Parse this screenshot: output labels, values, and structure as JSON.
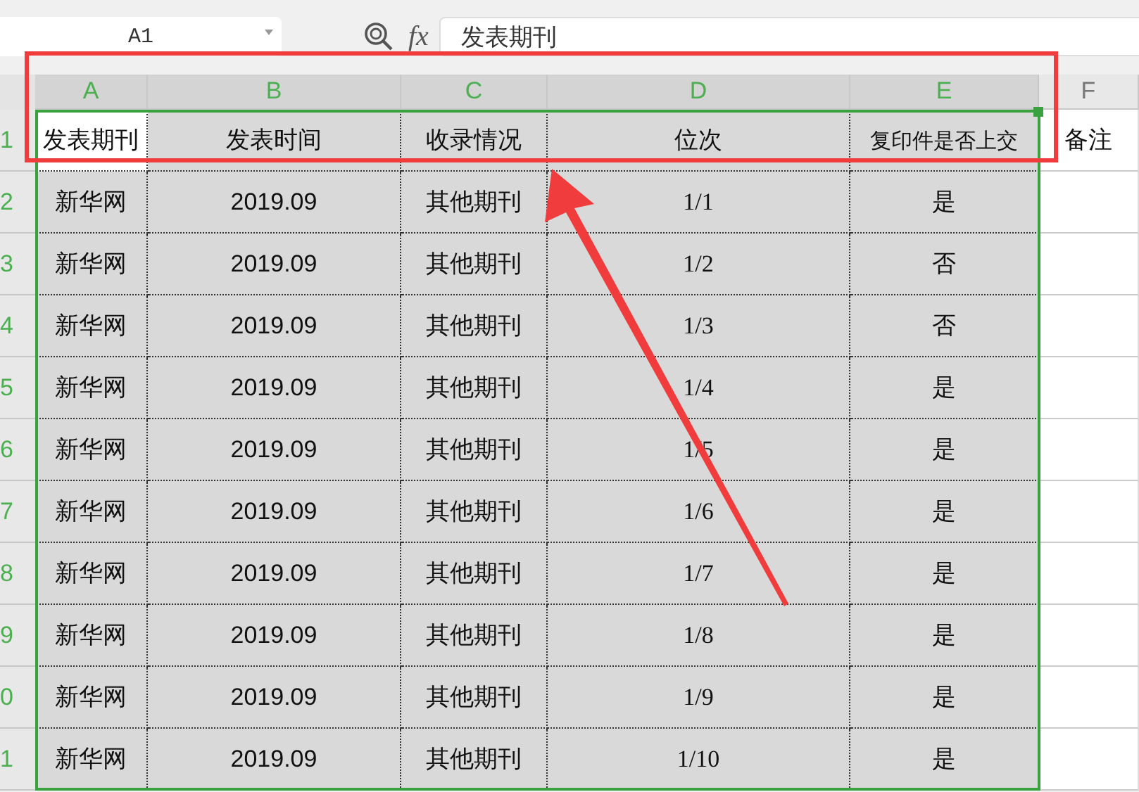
{
  "name_box": {
    "value": "A1"
  },
  "formula_bar": {
    "label": "fx",
    "value": "发表期刊"
  },
  "columns": [
    {
      "label": "A",
      "selected": true
    },
    {
      "label": "B",
      "selected": true
    },
    {
      "label": "C",
      "selected": true
    },
    {
      "label": "D",
      "selected": true
    },
    {
      "label": "E",
      "selected": true
    },
    {
      "label": "F",
      "selected": false
    }
  ],
  "rows": [
    {
      "number": "1",
      "cells": [
        {
          "text": "发表期刊",
          "selected": true,
          "active": true
        },
        {
          "text": "发表时间",
          "selected": true,
          "active": false
        },
        {
          "text": "收录情况",
          "selected": true,
          "active": false
        },
        {
          "text": "位次",
          "selected": true,
          "active": false
        },
        {
          "text": "复印件是否上交",
          "selected": true,
          "active": false
        },
        {
          "text": "备注",
          "selected": false,
          "active": false
        }
      ]
    },
    {
      "number": "2",
      "cells": [
        {
          "text": "新华网",
          "selected": true,
          "active": false
        },
        {
          "text": "2019.09",
          "selected": true,
          "active": false
        },
        {
          "text": "其他期刊",
          "selected": true,
          "active": false
        },
        {
          "text": "1/1",
          "selected": true,
          "active": false
        },
        {
          "text": "是",
          "selected": true,
          "active": false
        },
        {
          "selected": false,
          "active": false
        }
      ]
    },
    {
      "number": "3",
      "cells": [
        {
          "text": "新华网",
          "selected": true,
          "active": false
        },
        {
          "text": "2019.09",
          "selected": true,
          "active": false
        },
        {
          "text": "其他期刊",
          "selected": true,
          "active": false
        },
        {
          "text": "1/2",
          "selected": true,
          "active": false
        },
        {
          "text": "否",
          "selected": true,
          "active": false
        },
        {
          "selected": false,
          "active": false
        }
      ]
    },
    {
      "number": "4",
      "cells": [
        {
          "text": "新华网",
          "selected": true,
          "active": false
        },
        {
          "text": "2019.09",
          "selected": true,
          "active": false
        },
        {
          "text": "其他期刊",
          "selected": true,
          "active": false
        },
        {
          "text": "1/3",
          "selected": true,
          "active": false
        },
        {
          "text": "否",
          "selected": true,
          "active": false
        },
        {
          "selected": false,
          "active": false
        }
      ]
    },
    {
      "number": "5",
      "cells": [
        {
          "text": "新华网",
          "selected": true,
          "active": false
        },
        {
          "text": "2019.09",
          "selected": true,
          "active": false
        },
        {
          "text": "其他期刊",
          "selected": true,
          "active": false
        },
        {
          "text": "1/4",
          "selected": true,
          "active": false
        },
        {
          "text": "是",
          "selected": true,
          "active": false
        },
        {
          "selected": false,
          "active": false
        }
      ]
    },
    {
      "number": "6",
      "cells": [
        {
          "text": "新华网",
          "selected": true,
          "active": false
        },
        {
          "text": "2019.09",
          "selected": true,
          "active": false
        },
        {
          "text": "其他期刊",
          "selected": true,
          "active": false
        },
        {
          "text": "1/5",
          "selected": true,
          "active": false
        },
        {
          "text": "是",
          "selected": true,
          "active": false
        },
        {
          "selected": false,
          "active": false
        }
      ]
    },
    {
      "number": "7",
      "cells": [
        {
          "text": "新华网",
          "selected": true,
          "active": false
        },
        {
          "text": "2019.09",
          "selected": true,
          "active": false
        },
        {
          "text": "其他期刊",
          "selected": true,
          "active": false
        },
        {
          "text": "1/6",
          "selected": true,
          "active": false
        },
        {
          "text": "是",
          "selected": true,
          "active": false
        },
        {
          "selected": false,
          "active": false
        }
      ]
    },
    {
      "number": "8",
      "cells": [
        {
          "text": "新华网",
          "selected": true,
          "active": false
        },
        {
          "text": "2019.09",
          "selected": true,
          "active": false
        },
        {
          "text": "其他期刊",
          "selected": true,
          "active": false
        },
        {
          "text": "1/7",
          "selected": true,
          "active": false
        },
        {
          "text": "是",
          "selected": true,
          "active": false
        },
        {
          "selected": false,
          "active": false
        }
      ]
    },
    {
      "number": "9",
      "cells": [
        {
          "text": "新华网",
          "selected": true,
          "active": false
        },
        {
          "text": "2019.09",
          "selected": true,
          "active": false
        },
        {
          "text": "其他期刊",
          "selected": true,
          "active": false
        },
        {
          "text": "1/8",
          "selected": true,
          "active": false
        },
        {
          "text": "是",
          "selected": true,
          "active": false
        },
        {
          "selected": false,
          "active": false
        }
      ]
    },
    {
      "number": "0",
      "cells": [
        {
          "text": "新华网",
          "selected": true,
          "active": false
        },
        {
          "text": "2019.09",
          "selected": true,
          "active": false
        },
        {
          "text": "其他期刊",
          "selected": true,
          "active": false
        },
        {
          "text": "1/9",
          "selected": true,
          "active": false
        },
        {
          "text": "是",
          "selected": true,
          "active": false
        },
        {
          "selected": false,
          "active": false
        }
      ]
    },
    {
      "number": "1",
      "cells": [
        {
          "text": "新华网",
          "selected": true,
          "active": false
        },
        {
          "text": "2019.09",
          "selected": true,
          "active": false
        },
        {
          "text": "其他期刊",
          "selected": true,
          "active": false
        },
        {
          "text": "1/10",
          "selected": true,
          "active": false
        },
        {
          "text": "是",
          "selected": true,
          "active": false
        },
        {
          "selected": false,
          "active": false
        }
      ]
    }
  ]
}
